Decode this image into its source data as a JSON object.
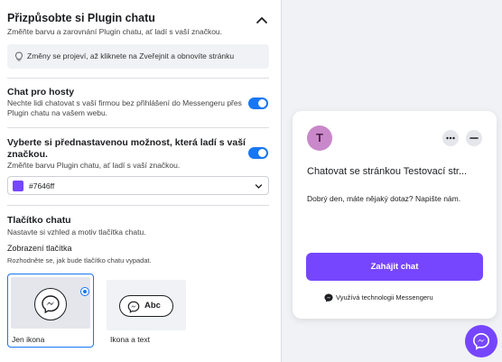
{
  "panel": {
    "title": "Přizpůsobte si Plugin chatu",
    "subtitle": "Změňte barvu a zarovnání Plugin chatu, ať ladí s vaší značkou.",
    "notice": "Změny se projeví, až kliknete na Zveřejnit a obnovíte stránku"
  },
  "guest_chat": {
    "title": "Chat pro hosty",
    "desc_line1": "Nechte lidi chatovat s vaší firmou bez přihlášení do Messengeru přes",
    "desc_line2": "Plugin chatu na vašem webu.",
    "enabled": true
  },
  "preset": {
    "title_line1": "Vyberte si přednastavenou možnost, která ladí s vaší",
    "title_line2": "značkou.",
    "desc": "Změňte barvu Plugin chatu, ať ladí s vaší značkou.",
    "enabled": true,
    "color_value": "#7646ff",
    "swatch_color": "#7646ff"
  },
  "chat_button": {
    "title": "Tlačítko chatu",
    "desc": "Nastavte si vzhled a motiv tlačítka chatu.",
    "display_title": "Zobrazení tlačítka",
    "display_desc": "Rozhodněte se, jak bude tlačítko chatu vypadat.",
    "options": [
      {
        "label": "Jen ikona",
        "selected": true
      },
      {
        "label": "Ikona a text",
        "selected": false,
        "pill_text": "Abc"
      }
    ]
  },
  "preview": {
    "avatar_letter": "T",
    "title": "Chatovat se stránkou Testovací str...",
    "greeting": "Dobrý den, máte nějaký dotaz? Napište nám.",
    "start_button": "Zahájit chat",
    "powered_by": "Využívá technologii Messengeru",
    "accent": "#7646ff"
  }
}
